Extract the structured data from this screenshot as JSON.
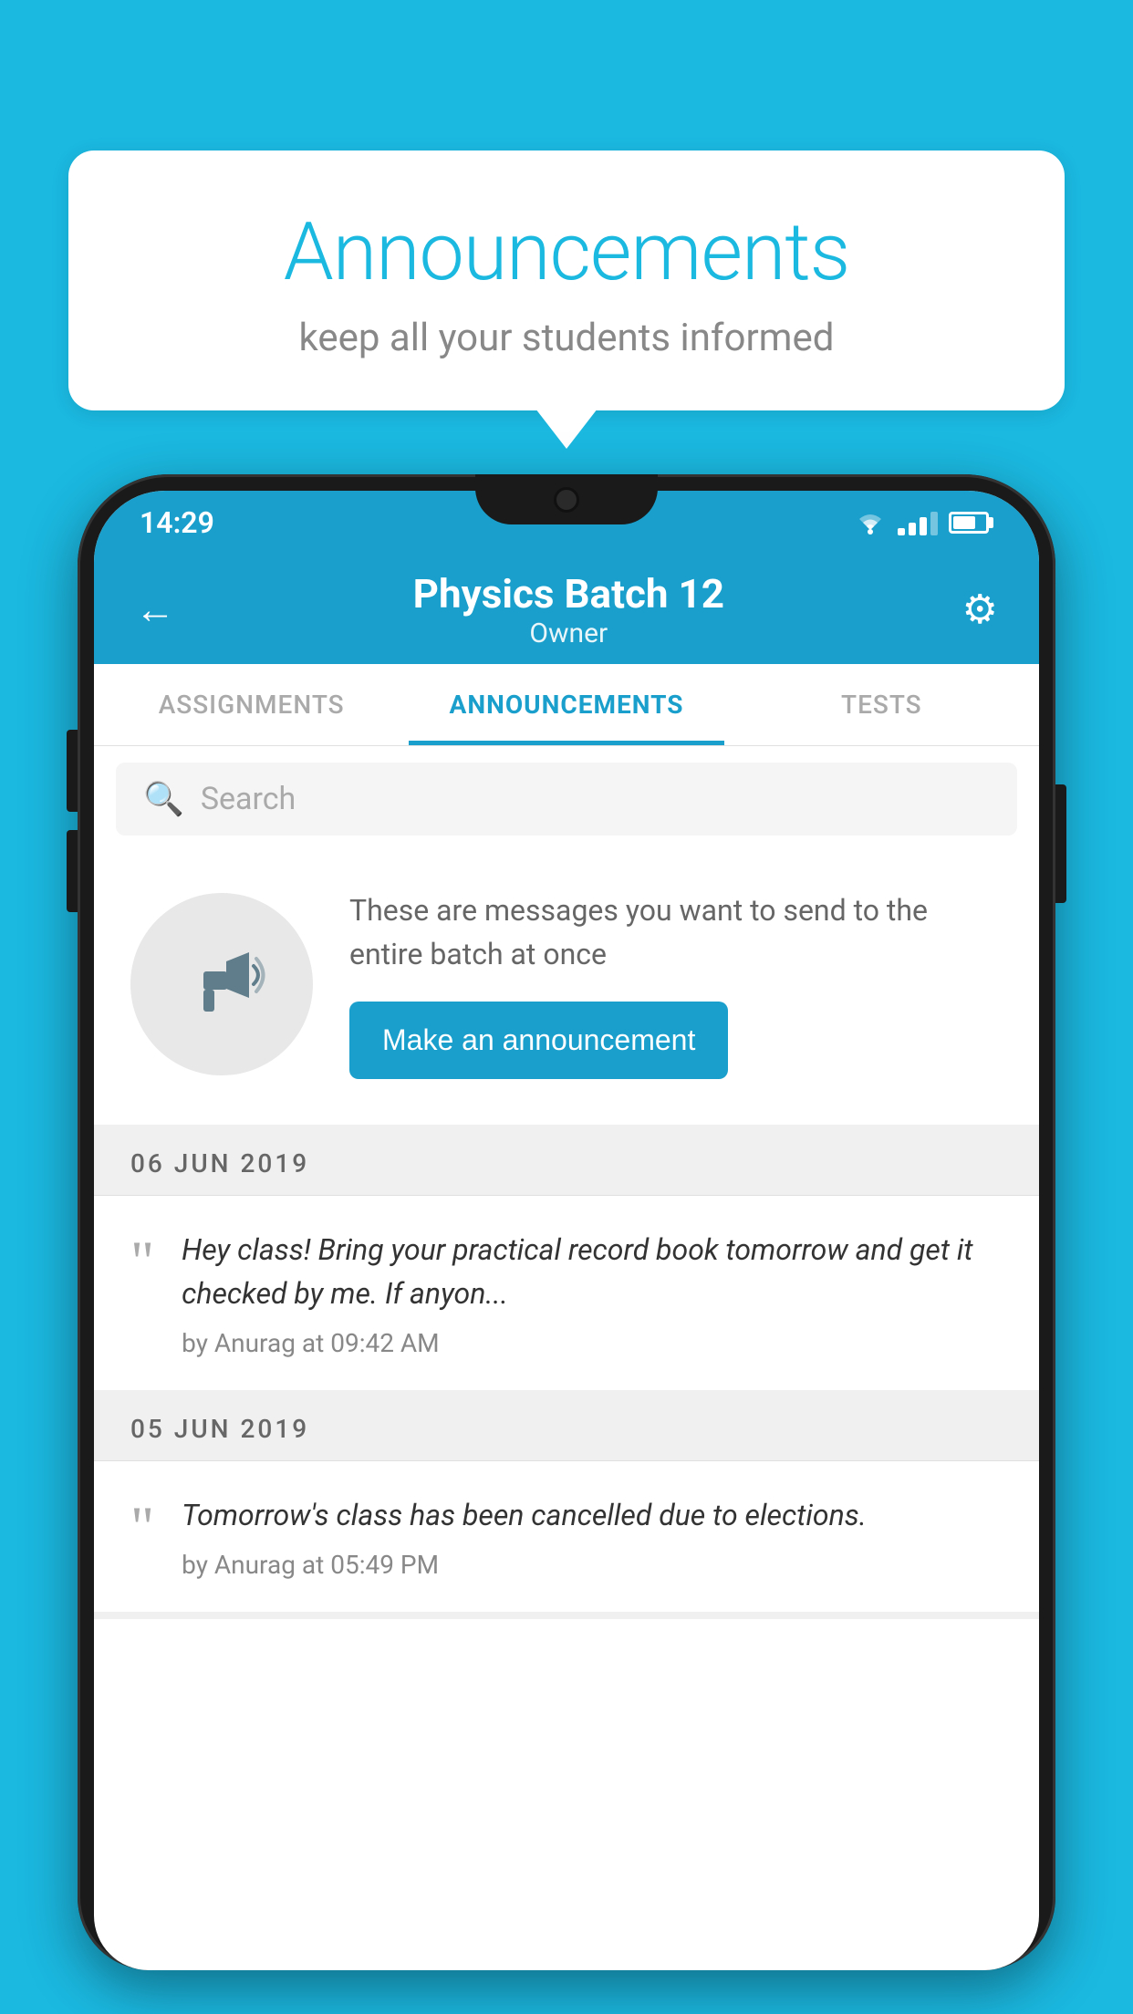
{
  "background_color": "#1BB8E0",
  "speech_bubble": {
    "title": "Announcements",
    "subtitle": "keep all your students informed"
  },
  "phone": {
    "status_bar": {
      "time": "14:29",
      "wifi": true,
      "signal": true,
      "battery": true
    },
    "header": {
      "title": "Physics Batch 12",
      "subtitle": "Owner",
      "back_label": "←",
      "settings_label": "⚙"
    },
    "tabs": [
      {
        "label": "ASSIGNMENTS",
        "active": false
      },
      {
        "label": "ANNOUNCEMENTS",
        "active": true
      },
      {
        "label": "TESTS",
        "active": false
      }
    ],
    "search": {
      "placeholder": "Search"
    },
    "announcement_prompt": {
      "description_text": "These are messages you want to send to the entire batch at once",
      "button_label": "Make an announcement"
    },
    "announcements": [
      {
        "date": "06  JUN  2019",
        "text": "Hey class! Bring your practical record book tomorrow and get it checked by me. If anyon...",
        "meta": "by Anurag at 09:42 AM"
      },
      {
        "date": "05  JUN  2019",
        "text": "Tomorrow's class has been cancelled due to elections.",
        "meta": "by Anurag at 05:49 PM"
      }
    ]
  }
}
